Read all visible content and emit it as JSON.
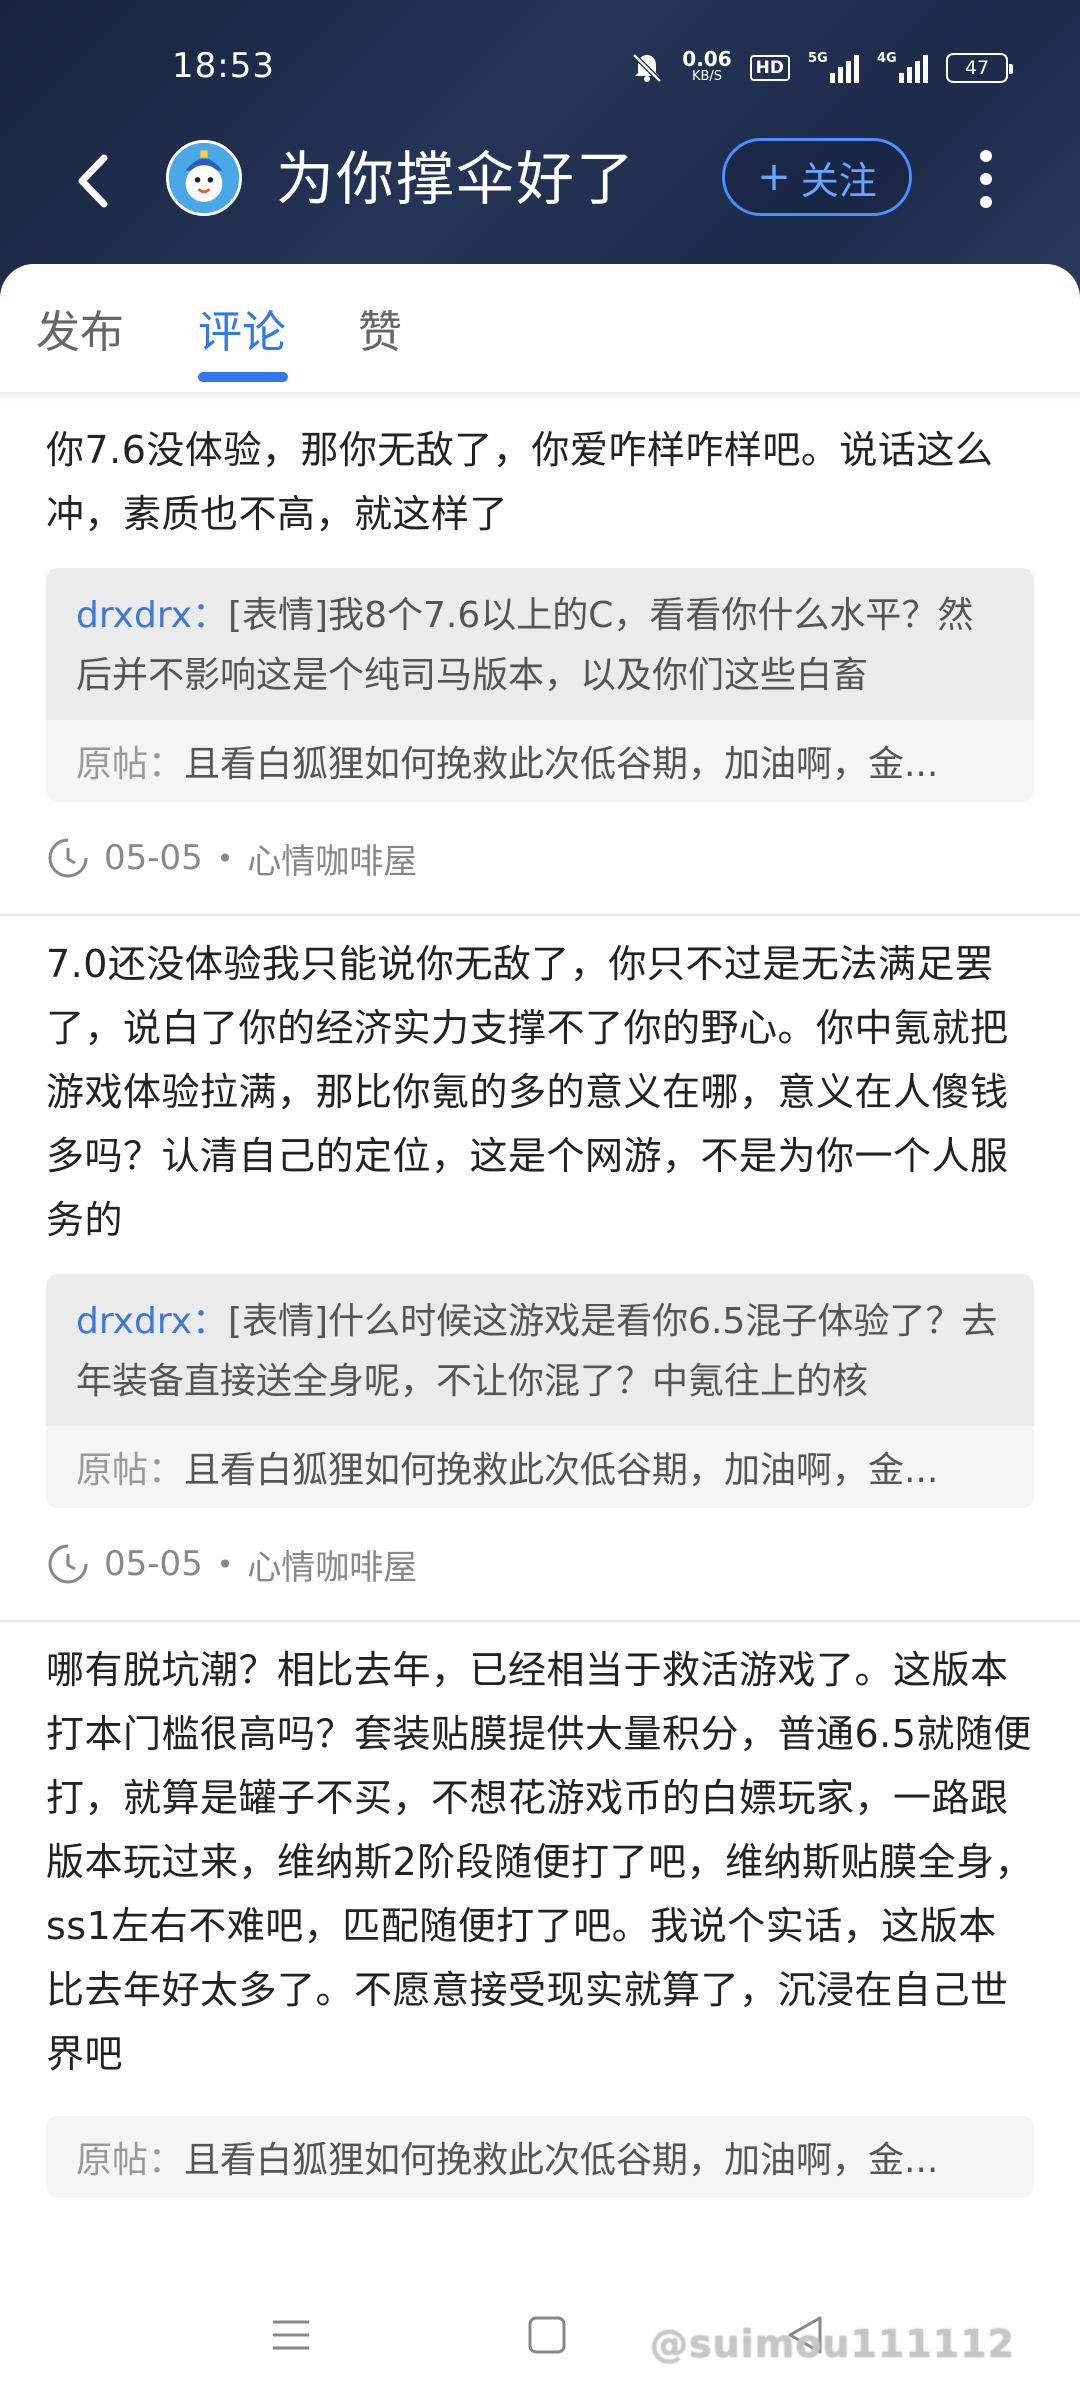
{
  "status_bar": {
    "time": "18:53",
    "net_speed_value": "0.06",
    "net_speed_unit": "KB/S",
    "hd_label": "HD",
    "signal1_label": "5G",
    "signal2_label": "4G",
    "battery": "47"
  },
  "header": {
    "title": "为你撑伞好了",
    "follow_label": "关注",
    "follow_plus": "+",
    "icons": [
      "back-arrow-icon",
      "avatar",
      "more-vertical-icon"
    ]
  },
  "tabs": [
    {
      "label": "发布",
      "active": false
    },
    {
      "label": "评论",
      "active": true
    },
    {
      "label": "赞",
      "active": false
    }
  ],
  "comments": [
    {
      "text": "你7.6没体验，那你无敌了，你爱咋样咋样吧。说话这么冲，素质也不高，就这样了",
      "reply_user": "drxdrx：",
      "reply_text": "[表情]我8个7.6以上的C，看看你什么水平？然后并不影响这是个纯司马版本，以及你们这些白畜",
      "origin_label": "原帖：",
      "origin_text": "且看白狐狸如何挽救此次低谷期，加油啊，金...",
      "date": "05-05",
      "forum": "心情咖啡屋"
    },
    {
      "text": "7.0还没体验我只能说你无敌了，你只不过是无法满足罢了，说白了你的经济实力支撑不了你的野心。你中氪就把游戏体验拉满，那比你氪的多的意义在哪，意义在人傻钱多吗？认清自己的定位，这是个网游，不是为你一个人服务的",
      "reply_user": "drxdrx：",
      "reply_text": "[表情]什么时候这游戏是看你6.5混子体验了？去年装备直接送全身呢，不让你混了？中氪往上的核",
      "origin_label": "原帖：",
      "origin_text": "且看白狐狸如何挽救此次低谷期，加油啊，金...",
      "date": "05-05",
      "forum": "心情咖啡屋"
    },
    {
      "text": "哪有脱坑潮？相比去年，已经相当于救活游戏了。这版本打本门槛很高吗？套装贴膜提供大量积分，普通6.5就随便打，就算是罐子不买，不想花游戏币的白嫖玩家，一路跟版本玩过来，维纳斯2阶段随便打了吧，维纳斯贴膜全身，ss1左右不难吧，匹配随便打了吧。我说个实话，这版本比去年好太多了。不愿意接受现实就算了，沉浸在自己世界吧",
      "origin_label": "原帖：",
      "origin_text": "且看白狐狸如何挽救此次低谷期，加油啊，金..."
    }
  ],
  "bottom_nav": {
    "icons": [
      "menu-icon",
      "home-square-icon",
      "back-triangle-icon"
    ],
    "watermark": "@suimou111112"
  }
}
